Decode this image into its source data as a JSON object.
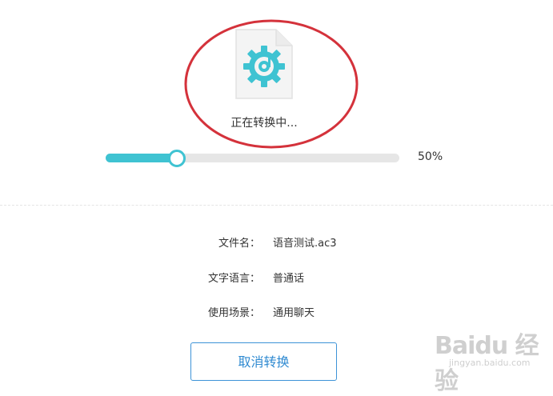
{
  "conversion": {
    "status_text": "正在转换中...",
    "progress": 0.5,
    "progress_label": "50%"
  },
  "file_info": [
    {
      "label": "文件名：",
      "value": "语音测试.ac3"
    },
    {
      "label": "文字语言：",
      "value": "普通话"
    },
    {
      "label": "使用场景：",
      "value": "通用聊天"
    }
  ],
  "cancel_button_label": "取消转换",
  "colors": {
    "accent": "#3fc3d2",
    "button_border": "#3d93d7",
    "annotation": "#d4323b"
  },
  "icons": [
    "file-gear-icon",
    "progress-thumb"
  ],
  "watermark": {
    "logo": "Baidu 经验",
    "sub": "jingyan.baidu.com"
  }
}
